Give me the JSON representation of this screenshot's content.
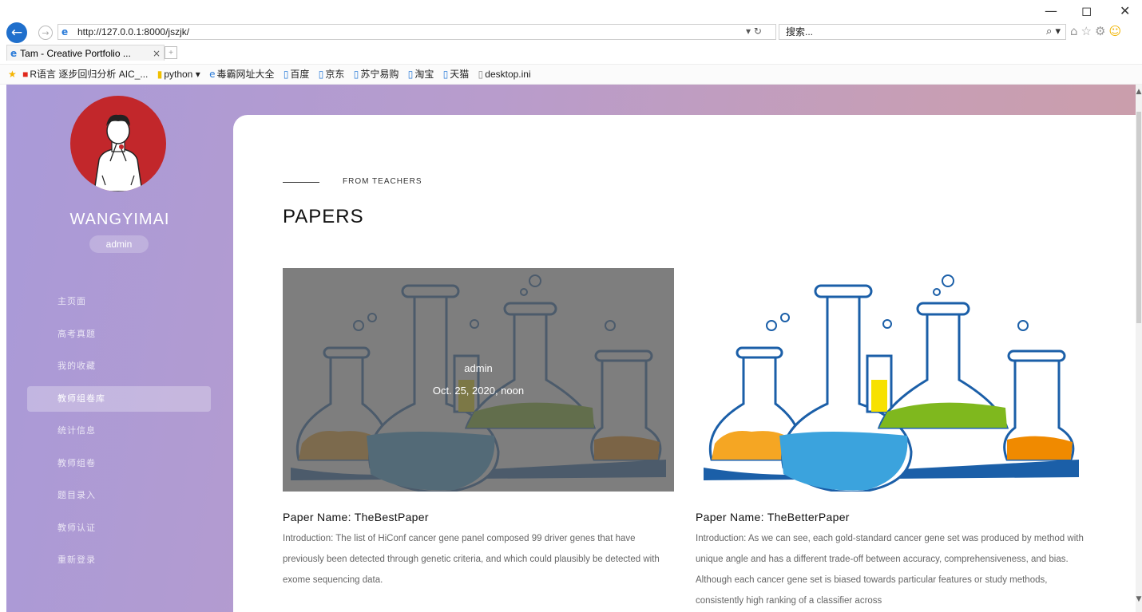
{
  "browser": {
    "window_controls": {
      "minimize": "—",
      "restore": "◻",
      "close": "✕"
    },
    "url": "http://127.0.0.1:8000/jszjk/",
    "search_placeholder": "搜索...",
    "tab_title": "Tam - Creative Portfolio ...",
    "favorites": [
      {
        "label": "R语言 逐步回归分析 AIC_...",
        "icon": "red"
      },
      {
        "label": "python ▾",
        "icon": "folder"
      },
      {
        "label": "毒霸网址大全",
        "icon": "ie"
      },
      {
        "label": "百度",
        "icon": "page"
      },
      {
        "label": "京东",
        "icon": "page"
      },
      {
        "label": "苏宁易购",
        "icon": "page"
      },
      {
        "label": "淘宝",
        "icon": "page"
      },
      {
        "label": "天猫",
        "icon": "page"
      },
      {
        "label": "desktop.ini",
        "icon": "file"
      }
    ]
  },
  "sidebar": {
    "username": "WANGYIMAI",
    "role": "admin",
    "items": [
      {
        "label": "主页面",
        "active": false
      },
      {
        "label": "高考真题",
        "active": false
      },
      {
        "label": "我的收藏",
        "active": false
      },
      {
        "label": "教师组卷库",
        "active": true
      },
      {
        "label": "统计信息",
        "active": false
      },
      {
        "label": "教师组卷",
        "active": false
      },
      {
        "label": "题目录入",
        "active": false
      },
      {
        "label": "教师认证",
        "active": false
      },
      {
        "label": "重新登录",
        "active": false
      }
    ]
  },
  "main": {
    "kicker": "FROM TEACHERS",
    "title": "PAPERS",
    "papers": [
      {
        "name": "Paper Name: TheBestPaper",
        "author": "admin",
        "date": "Oct. 25, 2020, noon",
        "intro": "Introduction: The list of HiConf cancer gene panel composed 99 driver genes that have previously been detected through genetic criteria, and which could plausibly be detected with exome sequencing data.",
        "hovered": true
      },
      {
        "name": "Paper Name: TheBetterPaper",
        "intro": "Introduction: As we can see, each gold-standard cancer gene set was produced by method with unique angle and has a different trade-off between accuracy, comprehensiveness, and bias. Although each cancer gene set is biased towards particular features or study methods, consistently high ranking of a classifier across",
        "hovered": false
      }
    ]
  }
}
